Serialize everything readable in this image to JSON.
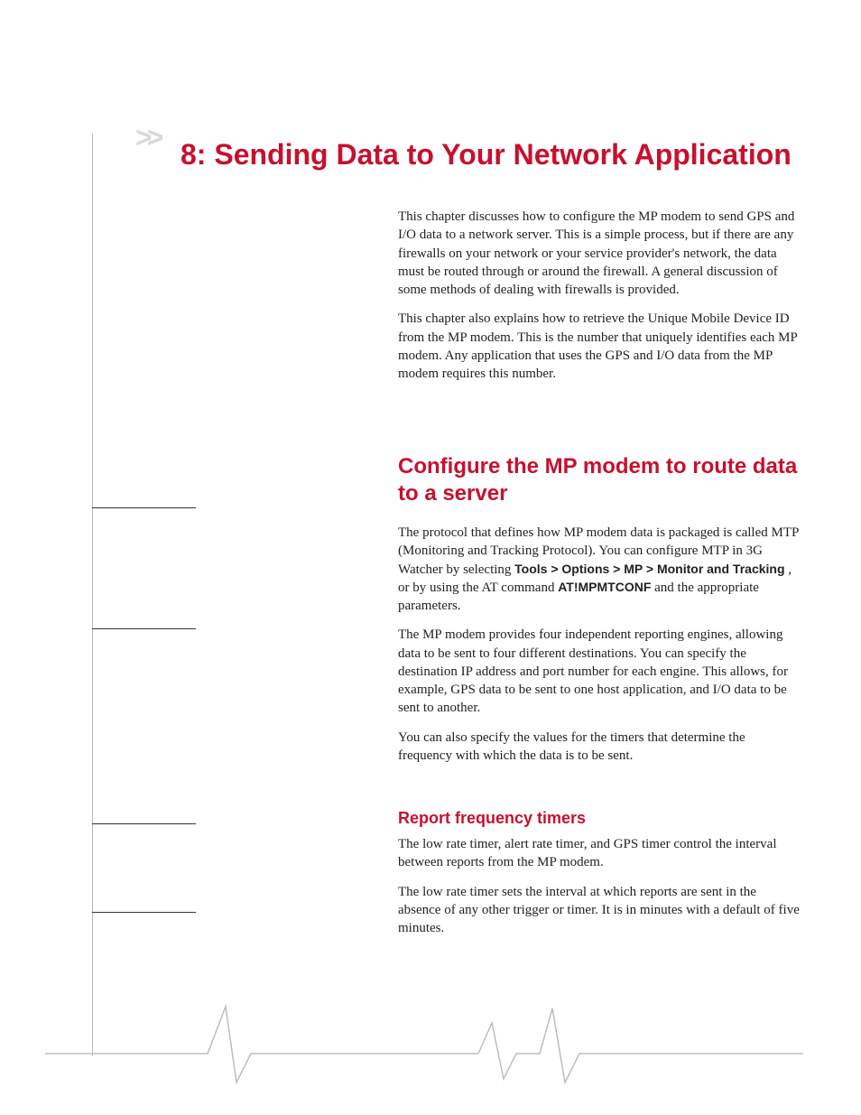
{
  "chapter": {
    "chevrons": ">>",
    "title": "8: Sending Data to Your Network Application"
  },
  "intro": {
    "p1": "This chapter discusses how to configure the MP modem to send GPS and I/O data to a network server. This is a simple process, but if there are any firewalls on your network or your service provider's network, the data must be routed through or around the firewall. A general discussion of some methods of dealing with firewalls is provided.",
    "p2": "This chapter also explains how to retrieve the Unique Mobile Device ID from the MP modem. This is the number that uniquely identifies each MP modem. Any application that uses the GPS and I/O data from the MP modem requires this number."
  },
  "section1": {
    "title": "Configure the MP modem to route data to a server",
    "p1a": "The protocol that defines how MP modem data is packaged is called MTP (Monitoring and Tracking Protocol). You can configure MTP in 3G Watcher by selecting ",
    "p1b": "Tools > Options > MP > Monitor and Tracking",
    "p1c": ", or by using the AT command ",
    "p1d": "AT!MPMTCONF",
    "p1e": " and the appropriate parameters.",
    "p2": "The MP modem provides four independent reporting engines, allowing data to be sent to four different destinations. You can specify the destination IP address and port number for each engine. This allows, for example, GPS data to be sent to one host application, and I/O data to be sent to another.",
    "p3": "You can also specify the values for the timers that determine the frequency with which the data is to be sent."
  },
  "subsection": {
    "title": "Report frequency timers",
    "p1": "The low rate timer, alert rate timer, and GPS timer control the interval between reports from the MP modem.",
    "p2": "The low rate timer sets the interval at which reports are sent in the absence of any other trigger or timer. It is in minutes with a default of five minutes."
  }
}
